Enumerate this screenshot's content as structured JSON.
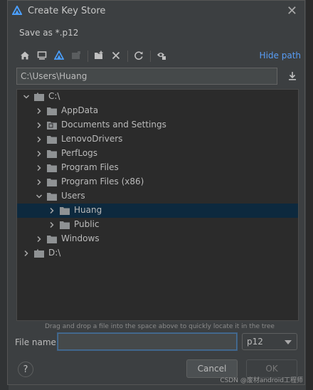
{
  "dialog": {
    "title": "Create Key Store",
    "subtitle": "Save as *.p12",
    "close_label": "✕"
  },
  "toolbar": {
    "buttons": [
      "home-icon",
      "desktop-icon",
      "project-icon",
      "module-icon",
      "new-folder-icon",
      "delete-icon",
      "refresh-icon",
      "show-hidden-icon"
    ],
    "hide_path_label": "Hide path"
  },
  "path": {
    "value": "C:\\Users\\Huang"
  },
  "tree": {
    "rows": [
      {
        "label": "C:\\",
        "depth": 0,
        "expanded": true,
        "drive": true
      },
      {
        "label": "AppData",
        "depth": 1,
        "expanded": false
      },
      {
        "label": "Documents and Settings",
        "depth": 1,
        "expanded": false,
        "link": true
      },
      {
        "label": "LenovoDrivers",
        "depth": 1,
        "expanded": false
      },
      {
        "label": "PerfLogs",
        "depth": 1,
        "expanded": false
      },
      {
        "label": "Program Files",
        "depth": 1,
        "expanded": false
      },
      {
        "label": "Program Files (x86)",
        "depth": 1,
        "expanded": false
      },
      {
        "label": "Users",
        "depth": 1,
        "expanded": true
      },
      {
        "label": "Huang",
        "depth": 2,
        "expanded": false,
        "selected": true
      },
      {
        "label": "Public",
        "depth": 2,
        "expanded": false
      },
      {
        "label": "Windows",
        "depth": 1,
        "expanded": false
      },
      {
        "label": "D:\\",
        "depth": 0,
        "expanded": false,
        "drive": true
      }
    ]
  },
  "hint": "Drag and drop a file into the space above to quickly locate it in the tree",
  "file_name": {
    "label": "File name:",
    "value": ""
  },
  "extension": {
    "selected": "p12"
  },
  "buttons": {
    "help": "?",
    "cancel": "Cancel",
    "ok": "OK"
  },
  "watermark": "CSDN @废材android工程师",
  "colors": {
    "dialog_bg": "#3c3f41",
    "tree_bg": "#2b2b2b",
    "selection": "#0d293e",
    "link": "#589df6",
    "accent_logo": "#4a9df8"
  }
}
